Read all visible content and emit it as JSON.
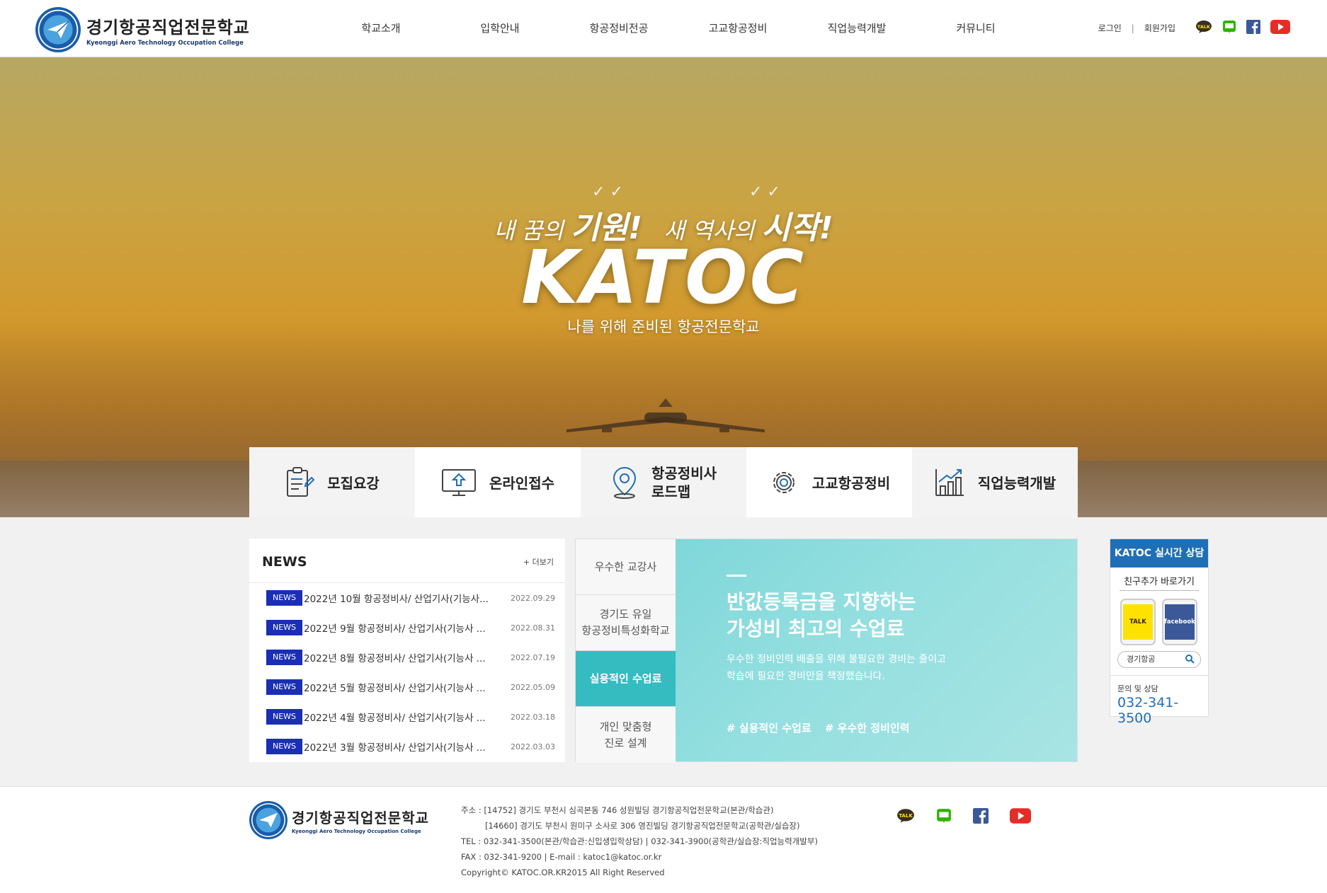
{
  "header": {
    "logo_ko": "경기항공직업전문학교",
    "logo_en": "Kyeonggi Aero Technology Occupation College",
    "gnb": [
      "학교소개",
      "입학안내",
      "항공정비전공",
      "고교항공정비",
      "직업능력개발",
      "커뮤니티"
    ],
    "login": "로그인",
    "sep": "|",
    "join": "회원가입",
    "sns_icons": [
      "kakaotalk-icon",
      "blog-icon",
      "facebook-icon",
      "youtube-icon"
    ]
  },
  "hero": {
    "slogan_a1": "내 꿈의",
    "slogan_a2": "기원!",
    "slogan_b1": "새 역사의",
    "slogan_b2": "시작!",
    "title": "KATOC",
    "subtitle": "나를 위해 준비된 항공전문학교"
  },
  "quick_menu": [
    {
      "label": "모집요강",
      "icon": "document-icon"
    },
    {
      "label": "온라인접수",
      "icon": "monitor-upload-icon"
    },
    {
      "label_line1": "항공정비사",
      "label_line2": "로드맵",
      "icon": "map-pin-icon"
    },
    {
      "label": "고교항공정비",
      "icon": "gear-icon"
    },
    {
      "label": "직업능력개발",
      "icon": "growth-chart-icon"
    }
  ],
  "news": {
    "title": "NEWS",
    "more": "+ 더보기",
    "items": [
      {
        "badge": "NEWS",
        "text": "2022년 10월 항공정비사/ 산업기사(기능사...",
        "date": "2022.09.29"
      },
      {
        "badge": "NEWS",
        "text": "2022년 9월 항공정비사/ 산업기사(기능사 ...",
        "date": "2022.08.31"
      },
      {
        "badge": "NEWS",
        "text": "2022년 8월 항공정비사/ 산업기사(기능사 ...",
        "date": "2022.07.19"
      },
      {
        "badge": "NEWS",
        "text": "2022년 5월 항공정비사/ 산업기사(기능사 ...",
        "date": "2022.05.09"
      },
      {
        "badge": "NEWS",
        "text": "2022년 4월 항공정비사/ 산업기사(기능사 ...",
        "date": "2022.03.18"
      },
      {
        "badge": "NEWS",
        "text": "2022년 3월 항공정비사/ 산업기사(기능사 ...",
        "date": "2022.03.03"
      }
    ]
  },
  "feature": {
    "tabs": [
      {
        "line1": "우수한 교강사",
        "line2": ""
      },
      {
        "line1": "경기도 유일",
        "line2": "항공정비특성화학교"
      },
      {
        "line1": "실용적인 수업료",
        "line2": ""
      },
      {
        "line1": "개인 맞춤형",
        "line2": "진로 설계"
      }
    ],
    "active_tab": 2,
    "heading_line1": "반값등록금을 지향하는",
    "heading_line2": "가성비 최고의 수업료",
    "desc_line1": "우수한 정비인력 배출을 위해 불필요한 경비는 줄이고",
    "desc_line2": "학습에 필요한 경비만을 책정했습니다.",
    "tag1": "# 실용적인 수업료",
    "tag2": "# 우수한 정비인력",
    "accent": "#34bcc1"
  },
  "consult": {
    "title": "KATOC 실시간 상담",
    "subtitle": "친구추가 바로가기",
    "talk": "TALK",
    "facebook": "facebook",
    "search_value": "경기항공",
    "label": "문의 및 상담",
    "phone": "032-341-3500"
  },
  "footer": {
    "logo_ko": "경기항공직업전문학교",
    "logo_en": "Kyeonggi Aero Technology Occupation College",
    "addr1": "주소 : [14752] 경기도 부천시 심곡본동 746 성원빌딩 경기항공직업전문학교(본관/학습관)",
    "addr2": "[14660] 경기도 부천시 원미구 소사로 306 영진빌딩 경기항공직업전문학교(공학관/실습장)",
    "tel": "TEL : 032-341-3500(본관/학습관:신입생입학상담) | 032-341-3900(공학관/실습장:직업능력개발부)",
    "fax": "FAX : 032-341-9200 | E-mail : katoc1@katoc.or.kr",
    "copyright": "Copyright© KATOC.OR.KR2015 All Right Reserved"
  }
}
